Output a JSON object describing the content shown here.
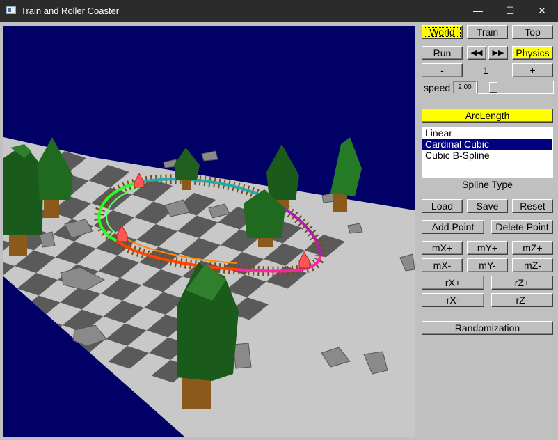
{
  "window": {
    "title": "Train and Roller Coaster",
    "minimize": "—",
    "maximize": "☐",
    "close": "✕"
  },
  "view_buttons": {
    "world": "World",
    "train": "Train",
    "top": "Top"
  },
  "play": {
    "run": "Run",
    "prev": "◀◀",
    "next": "▶▶",
    "physics": "Physics"
  },
  "counter": {
    "minus": "-",
    "value": "1",
    "plus": "+"
  },
  "speed": {
    "label": "speed",
    "value": "2.00",
    "level": 0.17
  },
  "arclength": "ArcLength",
  "spline": {
    "options": [
      "Linear",
      "Cardinal Cubic",
      "Cubic B-Spline"
    ],
    "selected_index": 1,
    "label": "Spline Type"
  },
  "file": {
    "load": "Load",
    "save": "Save",
    "reset": "Reset"
  },
  "points": {
    "add": "Add Point",
    "delete": "Delete Point"
  },
  "move": {
    "mx_plus": "mX+",
    "my_plus": "mY+",
    "mz_plus": "mZ+",
    "mx_minus": "mX-",
    "my_minus": "mY-",
    "mz_minus": "mZ-"
  },
  "rotate": {
    "rx_plus": "rX+",
    "rz_plus": "rZ+",
    "rx_minus": "rX-",
    "rz_minus": "rZ-"
  },
  "randomization": "Randomization",
  "colors": {
    "highlight": "#ffff00",
    "sky": "#000066",
    "panel": "#c0c0c0",
    "selection": "#000080"
  }
}
